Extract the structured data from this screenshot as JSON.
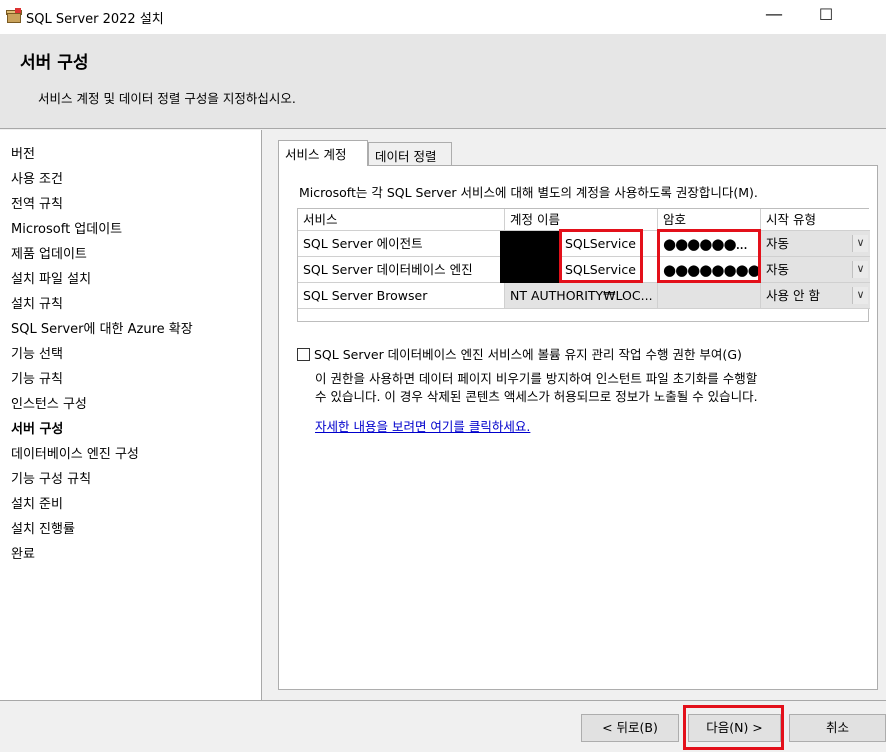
{
  "window": {
    "title": "SQL Server 2022 설치",
    "minimize_glyph": "—",
    "maximize_glyph": "☐"
  },
  "header": {
    "title": "서버 구성",
    "description": "서비스 계정 및 데이터 정렬 구성을 지정하십시오."
  },
  "nav": {
    "items": [
      "버전",
      "사용 조건",
      "전역 규칙",
      "Microsoft 업데이트",
      "제품 업데이트",
      "설치 파일 설치",
      "설치 규칙",
      "SQL Server에 대한 Azure 확장",
      "기능 선택",
      "기능 규칙",
      "인스턴스 구성",
      "서버 구성",
      "데이터베이스 엔진 구성",
      "기능 구성 규칙",
      "설치 준비",
      "설치 진행률",
      "완료"
    ],
    "active_index": 11
  },
  "tabs": [
    "서비스 계정",
    "데이터 정렬"
  ],
  "service_accounts": {
    "recommendation": "Microsoft는 각 SQL Server 서비스에 대해 별도의 계정을 사용하도록 권장합니다(M).",
    "columns": [
      "서비스",
      "계정 이름",
      "암호",
      "시작 유형"
    ],
    "rows": [
      {
        "service": "SQL Server 에이전트",
        "account": "SQLService",
        "password": "●●●●●●...",
        "startup": "자동"
      },
      {
        "service": "SQL Server 데이터베이스 엔진",
        "account": "SQLService",
        "password": "●●●●●●●●",
        "startup": "자동"
      },
      {
        "service": "SQL Server Browser",
        "account": "NT AUTHORITY₩LOC...",
        "password": "",
        "startup": "사용 안 함"
      }
    ],
    "dropdown_glyph": "∨",
    "volume_maintenance_checkbox": "SQL Server 데이터베이스 엔진 서비스에 볼륨 유지 관리 작업 수행 권한 부여(G)",
    "volume_maintenance_checked": false,
    "explanation_line1": "이 권한을 사용하면 데이터 페이지 비우기를 방지하여 인스턴트 파일 초기화를 수행할",
    "explanation_line2": "수 있습니다. 이 경우 삭제된 콘텐츠 액세스가 허용되므로 정보가 노출될 수 있습니다.",
    "details_link": "자세한 내용을 보려면 여기를 클릭하세요."
  },
  "footer": {
    "back": "< 뒤로(B)",
    "next": "다음(N) >",
    "cancel": "취소"
  },
  "colors": {
    "highlight_red": "#e3101a",
    "link_blue": "#0000cc"
  }
}
